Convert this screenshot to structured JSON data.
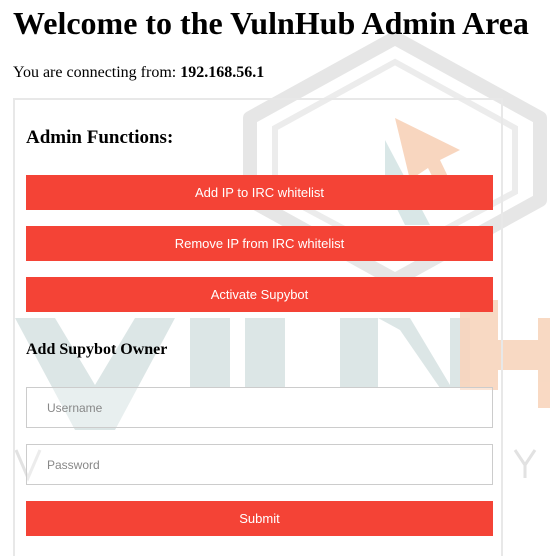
{
  "page": {
    "title": "Welcome to the VulnHub Admin Area",
    "connecting_label": "You are connecting from:",
    "client_ip": "192.168.56.1"
  },
  "admin_functions": {
    "heading": "Admin Functions:",
    "add_ip_label": "Add IP to IRC whitelist",
    "remove_ip_label": "Remove IP from IRC whitelist",
    "activate_supybot_label": "Activate Supybot"
  },
  "supybot_owner": {
    "heading": "Add Supybot Owner",
    "username_placeholder": "Username",
    "password_placeholder": "Password",
    "submit_label": "Submit"
  },
  "watermark": {
    "logo_text": "VULNHUB",
    "accent_color": "#f7c8a8",
    "base_color": "#d7e3e3"
  },
  "colors": {
    "button_red": "#f44336",
    "button_text": "#ffffff",
    "field_border": "#cccccc"
  }
}
